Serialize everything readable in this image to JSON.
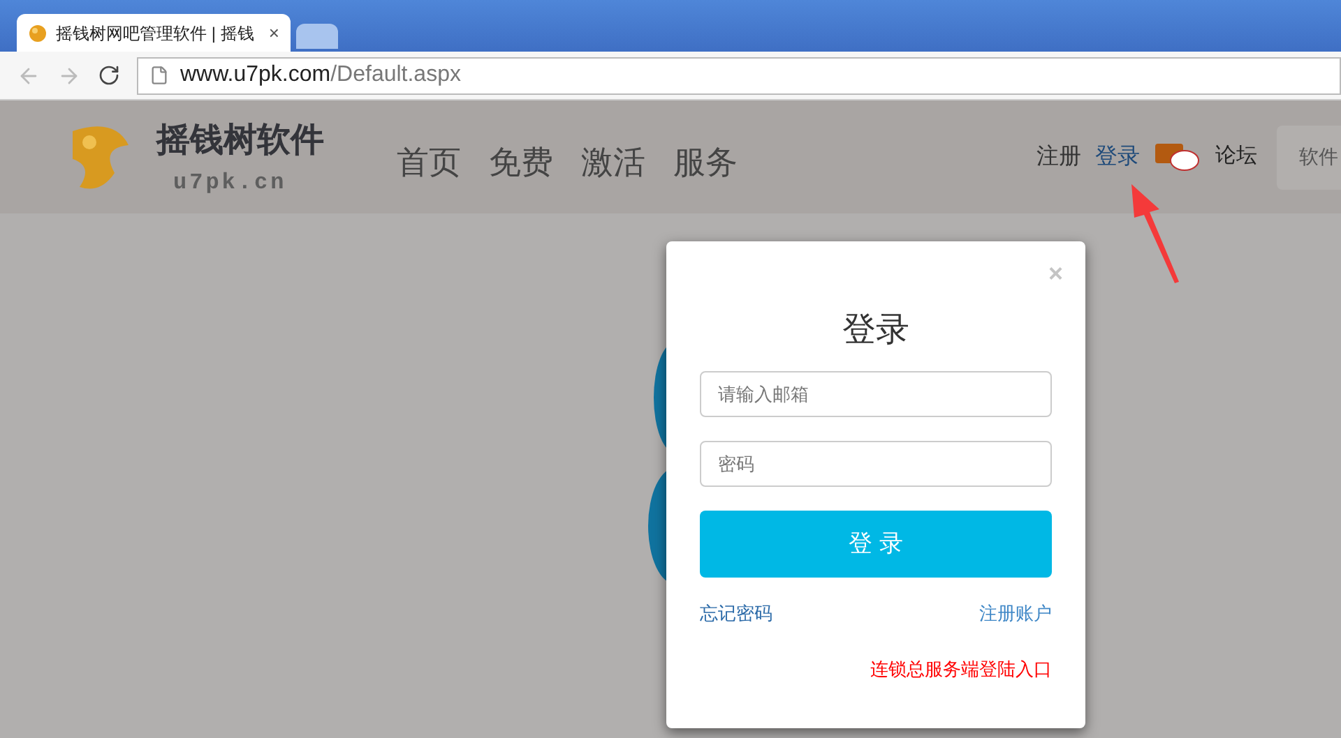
{
  "browser": {
    "tab": {
      "title": "摇钱树网吧管理软件 | 摇钱",
      "close": "×"
    },
    "url_host": "www.u7pk.com",
    "url_path": "/Default.aspx"
  },
  "header": {
    "brand": "摇钱树软件",
    "brand_sub": "u7pk.cn",
    "nav": [
      {
        "label": "首页"
      },
      {
        "label": "免费"
      },
      {
        "label": "激活"
      },
      {
        "label": "服务"
      }
    ],
    "links": [
      {
        "label": "注册"
      },
      {
        "label": "登录"
      }
    ],
    "forum": "论坛",
    "search_partial": "软件"
  },
  "modal": {
    "close": "×",
    "title": "登录",
    "email": {
      "placeholder": "请输入邮箱"
    },
    "password": {
      "placeholder": "密码"
    },
    "submit": "登 录",
    "forgot": "忘记密码",
    "register": "注册账户",
    "chain_login": "连锁总服务端登陆入口"
  }
}
